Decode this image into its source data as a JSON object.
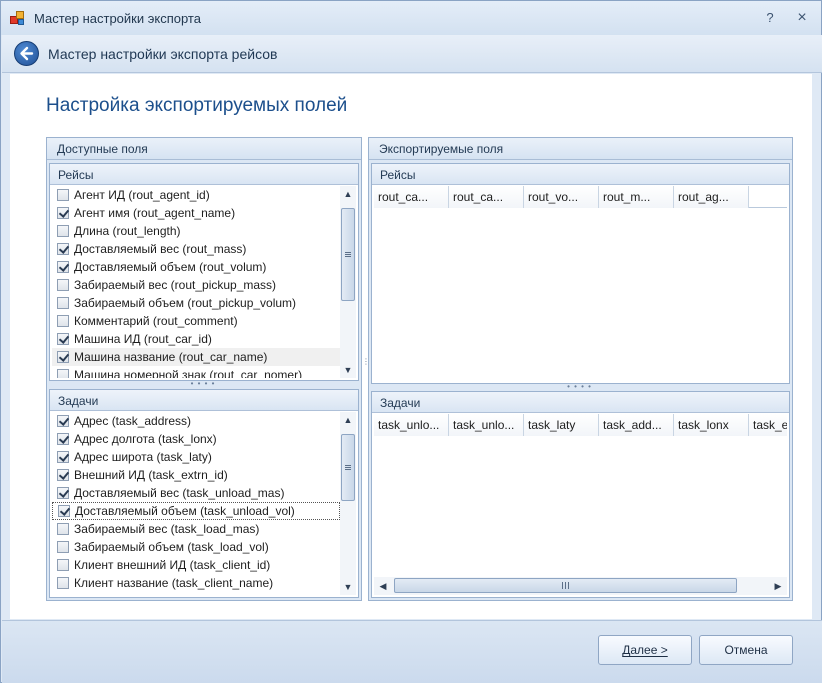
{
  "window": {
    "title": "Мастер настройки экспорта",
    "help_glyph": "?",
    "close_glyph": "×"
  },
  "wizard": {
    "header_title": "Мастер настройки экспорта рейсов"
  },
  "section_title": "Настройка экспортируемых полей",
  "available": {
    "label": "Доступные поля",
    "trips": {
      "label": "Рейсы",
      "items": [
        {
          "label": "Агент ИД (rout_agent_id)",
          "checked": false
        },
        {
          "label": "Агент имя (rout_agent_name)",
          "checked": true
        },
        {
          "label": "Длина (rout_length)",
          "checked": false
        },
        {
          "label": "Доставляемый вес (rout_mass)",
          "checked": true
        },
        {
          "label": "Доставляемый объем (rout_volum)",
          "checked": true
        },
        {
          "label": "Забираемый вес (rout_pickup_mass)",
          "checked": false
        },
        {
          "label": "Забираемый объем (rout_pickup_volum)",
          "checked": false
        },
        {
          "label": "Комментарий (rout_comment)",
          "checked": false
        },
        {
          "label": "Машина ИД (rout_car_id)",
          "checked": true
        },
        {
          "label": "Машина название (rout_car_name)",
          "checked": true
        },
        {
          "label": "Машина номерной знак (rout_car_nomer)",
          "checked": false
        }
      ]
    },
    "tasks": {
      "label": "Задачи",
      "items": [
        {
          "label": "Адрес (task_address)",
          "checked": true
        },
        {
          "label": "Адрес долгота (task_lonx)",
          "checked": true
        },
        {
          "label": "Адрес широта (task_laty)",
          "checked": true
        },
        {
          "label": "Внешний ИД (task_extrn_id)",
          "checked": true
        },
        {
          "label": "Доставляемый вес (task_unload_mas)",
          "checked": true
        },
        {
          "label": "Доставляемый объем (task_unload_vol)",
          "checked": true
        },
        {
          "label": "Забираемый вес (task_load_mas)",
          "checked": false
        },
        {
          "label": "Забираемый объем (task_load_vol)",
          "checked": false
        },
        {
          "label": "Клиент внешний ИД (task_client_id)",
          "checked": false
        },
        {
          "label": "Клиент название (task_client_name)",
          "checked": false
        }
      ]
    }
  },
  "exported": {
    "label": "Экспортируемые поля",
    "trips": {
      "label": "Рейсы",
      "columns": [
        "rout_ca...",
        "rout_ca...",
        "rout_vo...",
        "rout_m...",
        "rout_ag..."
      ]
    },
    "tasks": {
      "label": "Задачи",
      "columns": [
        "task_unlo...",
        "task_unlo...",
        "task_laty",
        "task_add...",
        "task_lonx",
        "task_e"
      ]
    }
  },
  "buttons": {
    "next": "Далее >",
    "cancel": "Отмена"
  },
  "colors": {
    "accent": "#1c4f8c",
    "frame": "#dfe9f5"
  }
}
